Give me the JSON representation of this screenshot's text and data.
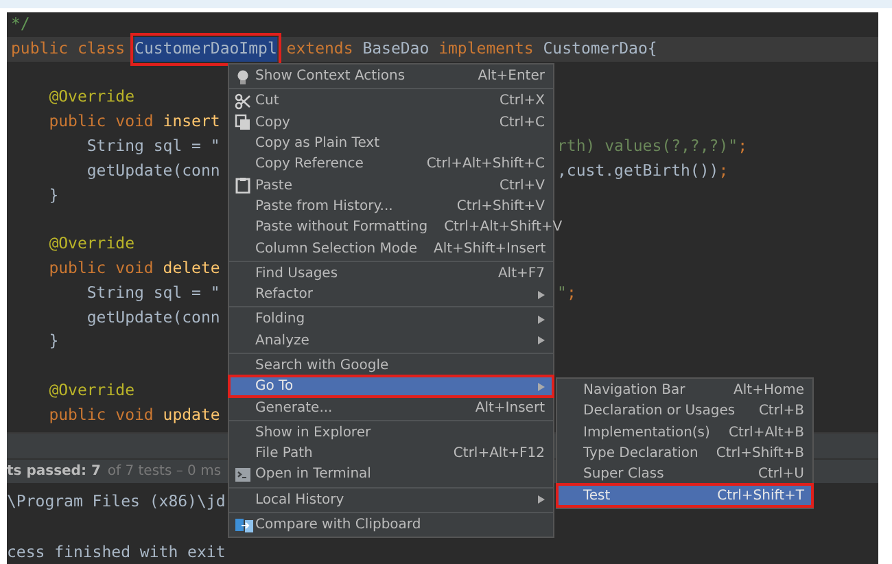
{
  "editor": {
    "lines": [
      {
        "current": false,
        "left": [
          {
            "text": "*/",
            "kind": "comment"
          }
        ]
      },
      {
        "current": true,
        "left": [
          {
            "text": "public class ",
            "kind": "keyword"
          },
          {
            "text": "CustomerDaoImpl",
            "kind": "selection",
            "marked": true
          },
          {
            "text": " extends ",
            "kind": "keyword"
          },
          {
            "text": "BaseDao ",
            "kind": "plain"
          },
          {
            "text": "implements ",
            "kind": "keyword"
          },
          {
            "text": "CustomerDao{",
            "kind": "plain"
          }
        ]
      },
      {
        "current": false
      },
      {
        "current": false,
        "left": [
          {
            "text": "    @Override",
            "kind": "annotation"
          }
        ]
      },
      {
        "current": false,
        "left": [
          {
            "text": "    public void ",
            "kind": "keyword"
          },
          {
            "text": "insert",
            "kind": "method"
          }
        ]
      },
      {
        "current": false,
        "left": [
          {
            "text": "        String sql = \"",
            "kind": "plain"
          }
        ],
        "right": [
          {
            "text": "rth) values(?,?,?)\"",
            "kind": "string"
          },
          {
            "text": ";",
            "kind": "keyword"
          }
        ]
      },
      {
        "current": false,
        "left": [
          {
            "text": "        getUpdate(conn",
            "kind": "plain"
          }
        ],
        "right": [
          {
            "text": ",cust.getBirth())",
            "kind": "plain"
          },
          {
            "text": ";",
            "kind": "keyword"
          }
        ]
      },
      {
        "current": false,
        "left": [
          {
            "text": "    }",
            "kind": "plain"
          }
        ]
      },
      {
        "current": false
      },
      {
        "current": false,
        "left": [
          {
            "text": "    @Override",
            "kind": "annotation"
          }
        ]
      },
      {
        "current": false,
        "left": [
          {
            "text": "    public void ",
            "kind": "keyword"
          },
          {
            "text": "delete",
            "kind": "method"
          }
        ]
      },
      {
        "current": false,
        "left": [
          {
            "text": "        String sql = \"",
            "kind": "plain"
          }
        ],
        "right": [
          {
            "text": "\"",
            "kind": "string"
          },
          {
            "text": ";",
            "kind": "keyword"
          }
        ]
      },
      {
        "current": false,
        "left": [
          {
            "text": "        getUpdate(conn",
            "kind": "plain"
          }
        ]
      },
      {
        "current": false,
        "left": [
          {
            "text": "    }",
            "kind": "plain"
          }
        ]
      },
      {
        "current": false
      },
      {
        "current": false,
        "left": [
          {
            "text": "    @Override",
            "kind": "annotation"
          }
        ]
      },
      {
        "current": false,
        "left": [
          {
            "text": "    public void ",
            "kind": "keyword"
          },
          {
            "text": "update",
            "kind": "method"
          }
        ]
      }
    ]
  },
  "run_panel": {
    "tests_passed": "ts passed: 7",
    "tests_detail": "of 7 tests – 0 ms",
    "console": [
      "\\Program Files (x86)\\jd",
      "cess finished with exit"
    ]
  },
  "context_menu": {
    "items": [
      {
        "kind": "item",
        "label": "Show Context Actions",
        "shortcut": "Alt+Enter",
        "submenu": false,
        "selected": false,
        "marked": false
      },
      {
        "kind": "separator"
      },
      {
        "kind": "item",
        "label": "Cut",
        "shortcut": "Ctrl+X",
        "submenu": false,
        "selected": false,
        "marked": false
      },
      {
        "kind": "item",
        "label": "Copy",
        "shortcut": "Ctrl+C",
        "submenu": false,
        "selected": false,
        "marked": false
      },
      {
        "kind": "item",
        "label": "Copy as Plain Text",
        "submenu": false,
        "selected": false,
        "marked": false
      },
      {
        "kind": "item",
        "label": "Copy Reference",
        "shortcut": "Ctrl+Alt+Shift+C",
        "submenu": false,
        "selected": false,
        "marked": false
      },
      {
        "kind": "item",
        "label": "Paste",
        "shortcut": "Ctrl+V",
        "submenu": false,
        "selected": false,
        "marked": false
      },
      {
        "kind": "item",
        "label": "Paste from History...",
        "shortcut": "Ctrl+Shift+V",
        "submenu": false,
        "selected": false,
        "marked": false
      },
      {
        "kind": "item",
        "label": "Paste without Formatting",
        "shortcut": "Ctrl+Alt+Shift+V",
        "submenu": false,
        "selected": false,
        "marked": false
      },
      {
        "kind": "item",
        "label": "Column Selection Mode",
        "shortcut": "Alt+Shift+Insert",
        "submenu": false,
        "selected": false,
        "marked": false
      },
      {
        "kind": "separator"
      },
      {
        "kind": "item",
        "label": "Find Usages",
        "shortcut": "Alt+F7",
        "submenu": false,
        "selected": false,
        "marked": false
      },
      {
        "kind": "item",
        "label": "Refactor",
        "submenu": true,
        "selected": false,
        "marked": false
      },
      {
        "kind": "separator"
      },
      {
        "kind": "item",
        "label": "Folding",
        "submenu": true,
        "selected": false,
        "marked": false
      },
      {
        "kind": "item",
        "label": "Analyze",
        "submenu": true,
        "selected": false,
        "marked": false
      },
      {
        "kind": "separator"
      },
      {
        "kind": "item",
        "label": "Search with Google",
        "submenu": false,
        "selected": false,
        "marked": false
      },
      {
        "kind": "item",
        "label": "Go To",
        "submenu": true,
        "selected": true,
        "marked": true
      },
      {
        "kind": "item",
        "label": "Generate...",
        "shortcut": "Alt+Insert",
        "submenu": false,
        "selected": false,
        "marked": false
      },
      {
        "kind": "separator"
      },
      {
        "kind": "item",
        "label": "Show in Explorer",
        "submenu": false,
        "selected": false,
        "marked": false
      },
      {
        "kind": "item",
        "label": "File Path",
        "shortcut": "Ctrl+Alt+F12",
        "submenu": false,
        "selected": false,
        "marked": false
      },
      {
        "kind": "item",
        "label": "Open in Terminal",
        "submenu": false,
        "selected": false,
        "marked": false
      },
      {
        "kind": "separator"
      },
      {
        "kind": "item",
        "label": "Local History",
        "submenu": true,
        "selected": false,
        "marked": false
      },
      {
        "kind": "separator"
      },
      {
        "kind": "item",
        "label": "Compare with Clipboard",
        "submenu": false,
        "selected": false,
        "marked": false
      }
    ]
  },
  "go_to_submenu": {
    "items": [
      {
        "kind": "item",
        "label": "Navigation Bar",
        "shortcut": "Alt+Home",
        "selected": false,
        "marked": false
      },
      {
        "kind": "item",
        "label": "Declaration or Usages",
        "shortcut": "Ctrl+B",
        "selected": false,
        "marked": false
      },
      {
        "kind": "item",
        "label": "Implementation(s)",
        "shortcut": "Ctrl+Alt+B",
        "selected": false,
        "marked": false
      },
      {
        "kind": "item",
        "label": "Type Declaration",
        "shortcut": "Ctrl+Shift+B",
        "selected": false,
        "marked": false
      },
      {
        "kind": "item",
        "label": "Super Class",
        "shortcut": "Ctrl+U",
        "selected": false,
        "marked": false
      },
      {
        "kind": "item",
        "label": "Test",
        "shortcut": "Ctrl+Shift+T",
        "selected": true,
        "marked": true
      }
    ]
  }
}
